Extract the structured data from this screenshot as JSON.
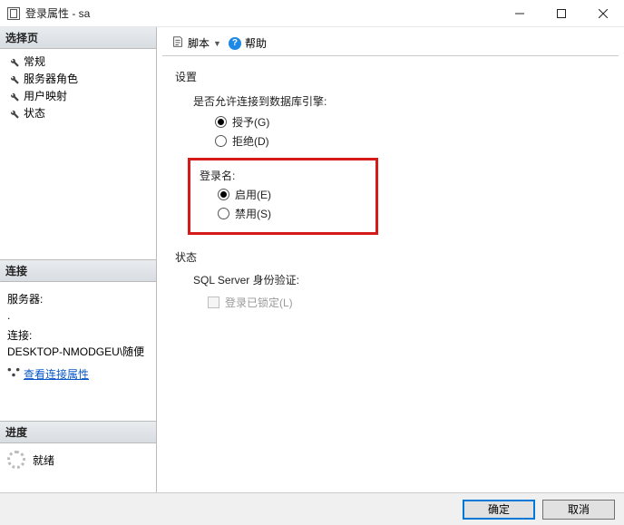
{
  "window": {
    "title": "登录属性 - sa"
  },
  "sidebar": {
    "select_page_header": "选择页",
    "pages": [
      {
        "label": "常规"
      },
      {
        "label": "服务器角色"
      },
      {
        "label": "用户映射"
      },
      {
        "label": "状态"
      }
    ],
    "connection_header": "连接",
    "server_label": "服务器:",
    "server_value": ".",
    "conn_label": "连接:",
    "conn_value": "DESKTOP-NMODGEU\\随便",
    "view_conn_props": "查看连接属性",
    "progress_header": "进度",
    "progress_status": "就绪"
  },
  "toolbar": {
    "script_label": "脚本",
    "help_label": "帮助"
  },
  "content": {
    "settings_label": "设置",
    "perm_label": "是否允许连接到数据库引擎:",
    "grant_label": "授予(G)",
    "deny_label": "拒绝(D)",
    "login_label": "登录名:",
    "enable_label": "启用(E)",
    "disable_label": "禁用(S)",
    "status_heading": "状态",
    "sql_auth_label": "SQL Server 身份验证:",
    "locked_label": "登录已锁定(L)"
  },
  "buttons": {
    "ok": "确定",
    "cancel": "取消"
  }
}
